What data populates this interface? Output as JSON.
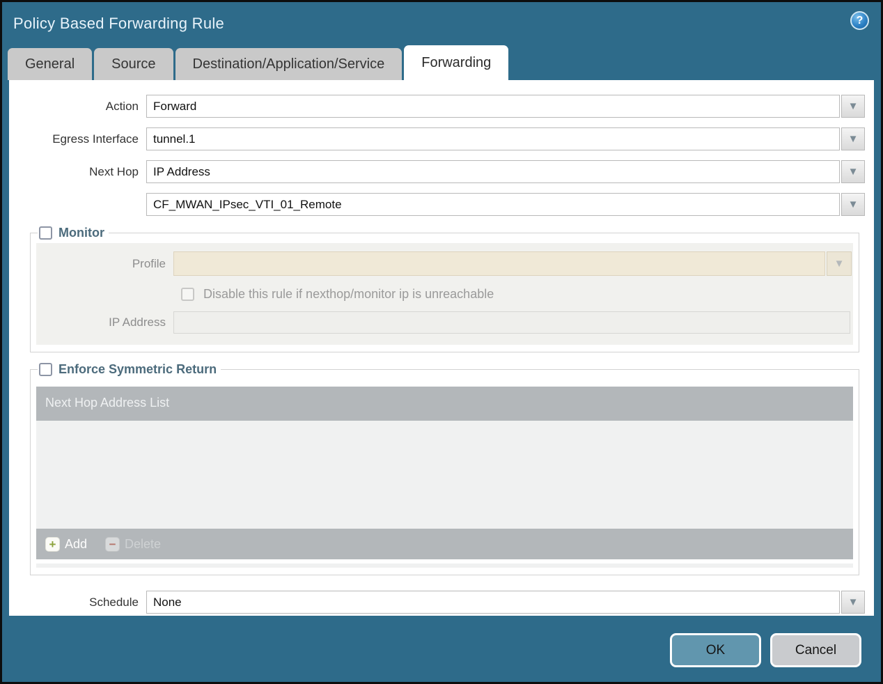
{
  "dialog": {
    "title": "Policy Based Forwarding Rule"
  },
  "icons": {
    "help": "?",
    "dropdown": "▼",
    "add": "+",
    "delete": "−"
  },
  "tabs": [
    {
      "label": "General",
      "active": false
    },
    {
      "label": "Source",
      "active": false
    },
    {
      "label": "Destination/Application/Service",
      "active": false
    },
    {
      "label": "Forwarding",
      "active": true
    }
  ],
  "form": {
    "action": {
      "label": "Action",
      "value": "Forward"
    },
    "egress_interface": {
      "label": "Egress Interface",
      "value": "tunnel.1"
    },
    "next_hop": {
      "label": "Next Hop",
      "value": "IP Address"
    },
    "next_hop_address": {
      "value": "CF_MWAN_IPsec_VTI_01_Remote"
    },
    "schedule": {
      "label": "Schedule",
      "value": "None"
    }
  },
  "monitor": {
    "legend": "Monitor",
    "checked": false,
    "profile_label": "Profile",
    "profile_value": "",
    "disable_rule_label": "Disable this rule if nexthop/monitor ip is unreachable",
    "ip_address_label": "IP Address",
    "ip_address_value": ""
  },
  "symmetric_return": {
    "legend": "Enforce Symmetric Return",
    "checked": false,
    "table_header": "Next Hop Address List",
    "rows": [],
    "add_label": "Add",
    "delete_label": "Delete"
  },
  "footer": {
    "ok_label": "OK",
    "cancel_label": "Cancel"
  },
  "colors": {
    "titlebar_teal": "#2e6b8a",
    "ok_button": "#6196ae",
    "cancel_button": "#c9cbce",
    "table_gray": "#b3b7ba",
    "profile_beige": "#f0e9d7",
    "active_tab": "#ffffff",
    "inactive_tab": "#c9c9c9"
  }
}
